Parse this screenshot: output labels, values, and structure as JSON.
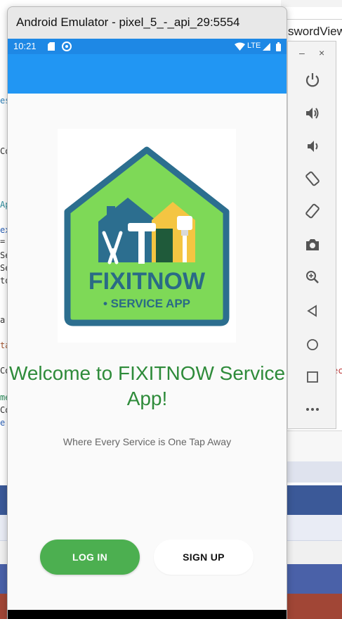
{
  "window": {
    "title": "Android Emulator - pixel_5_-_api_29:5554"
  },
  "background": {
    "tab_fragment": "swordView",
    "code_fragments": [
      "es",
      "Co",
      "Ap",
      "ex",
      "=",
      "Se",
      "Se",
      "to",
      "a",
      "ta",
      "Co",
      "me",
      "Co",
      "e",
      "ec"
    ]
  },
  "status_bar": {
    "time": "10:21",
    "network": "LTE",
    "icons": [
      "sd-card-icon",
      "sync-icon",
      "wifi-icon",
      "signal-icon",
      "battery-icon"
    ]
  },
  "app": {
    "logo": {
      "name": "FIXITNOW",
      "subtitle": "• SERVICE APP"
    },
    "welcome": "Welcome to FIXITNOW Service App!",
    "tagline": "Where Every Service is One Tap Away",
    "login_label": "LOG IN",
    "signup_label": "SIGN UP"
  },
  "toolbar": {
    "minimize": "–",
    "close": "×",
    "items": [
      "power-icon",
      "volume-up-icon",
      "volume-down-icon",
      "rotate-left-icon",
      "rotate-right-icon",
      "camera-icon",
      "zoom-icon",
      "back-icon",
      "home-icon",
      "overview-icon",
      "more-icon"
    ]
  },
  "colors": {
    "status_bar": "#1e88e5",
    "app_bar": "#2196f3",
    "welcome_text": "#2e8b3a",
    "login_button": "#4caf50",
    "logo_border": "#2c6e8f",
    "logo_green": "#7ed957",
    "logo_text": "#2a6a86"
  }
}
